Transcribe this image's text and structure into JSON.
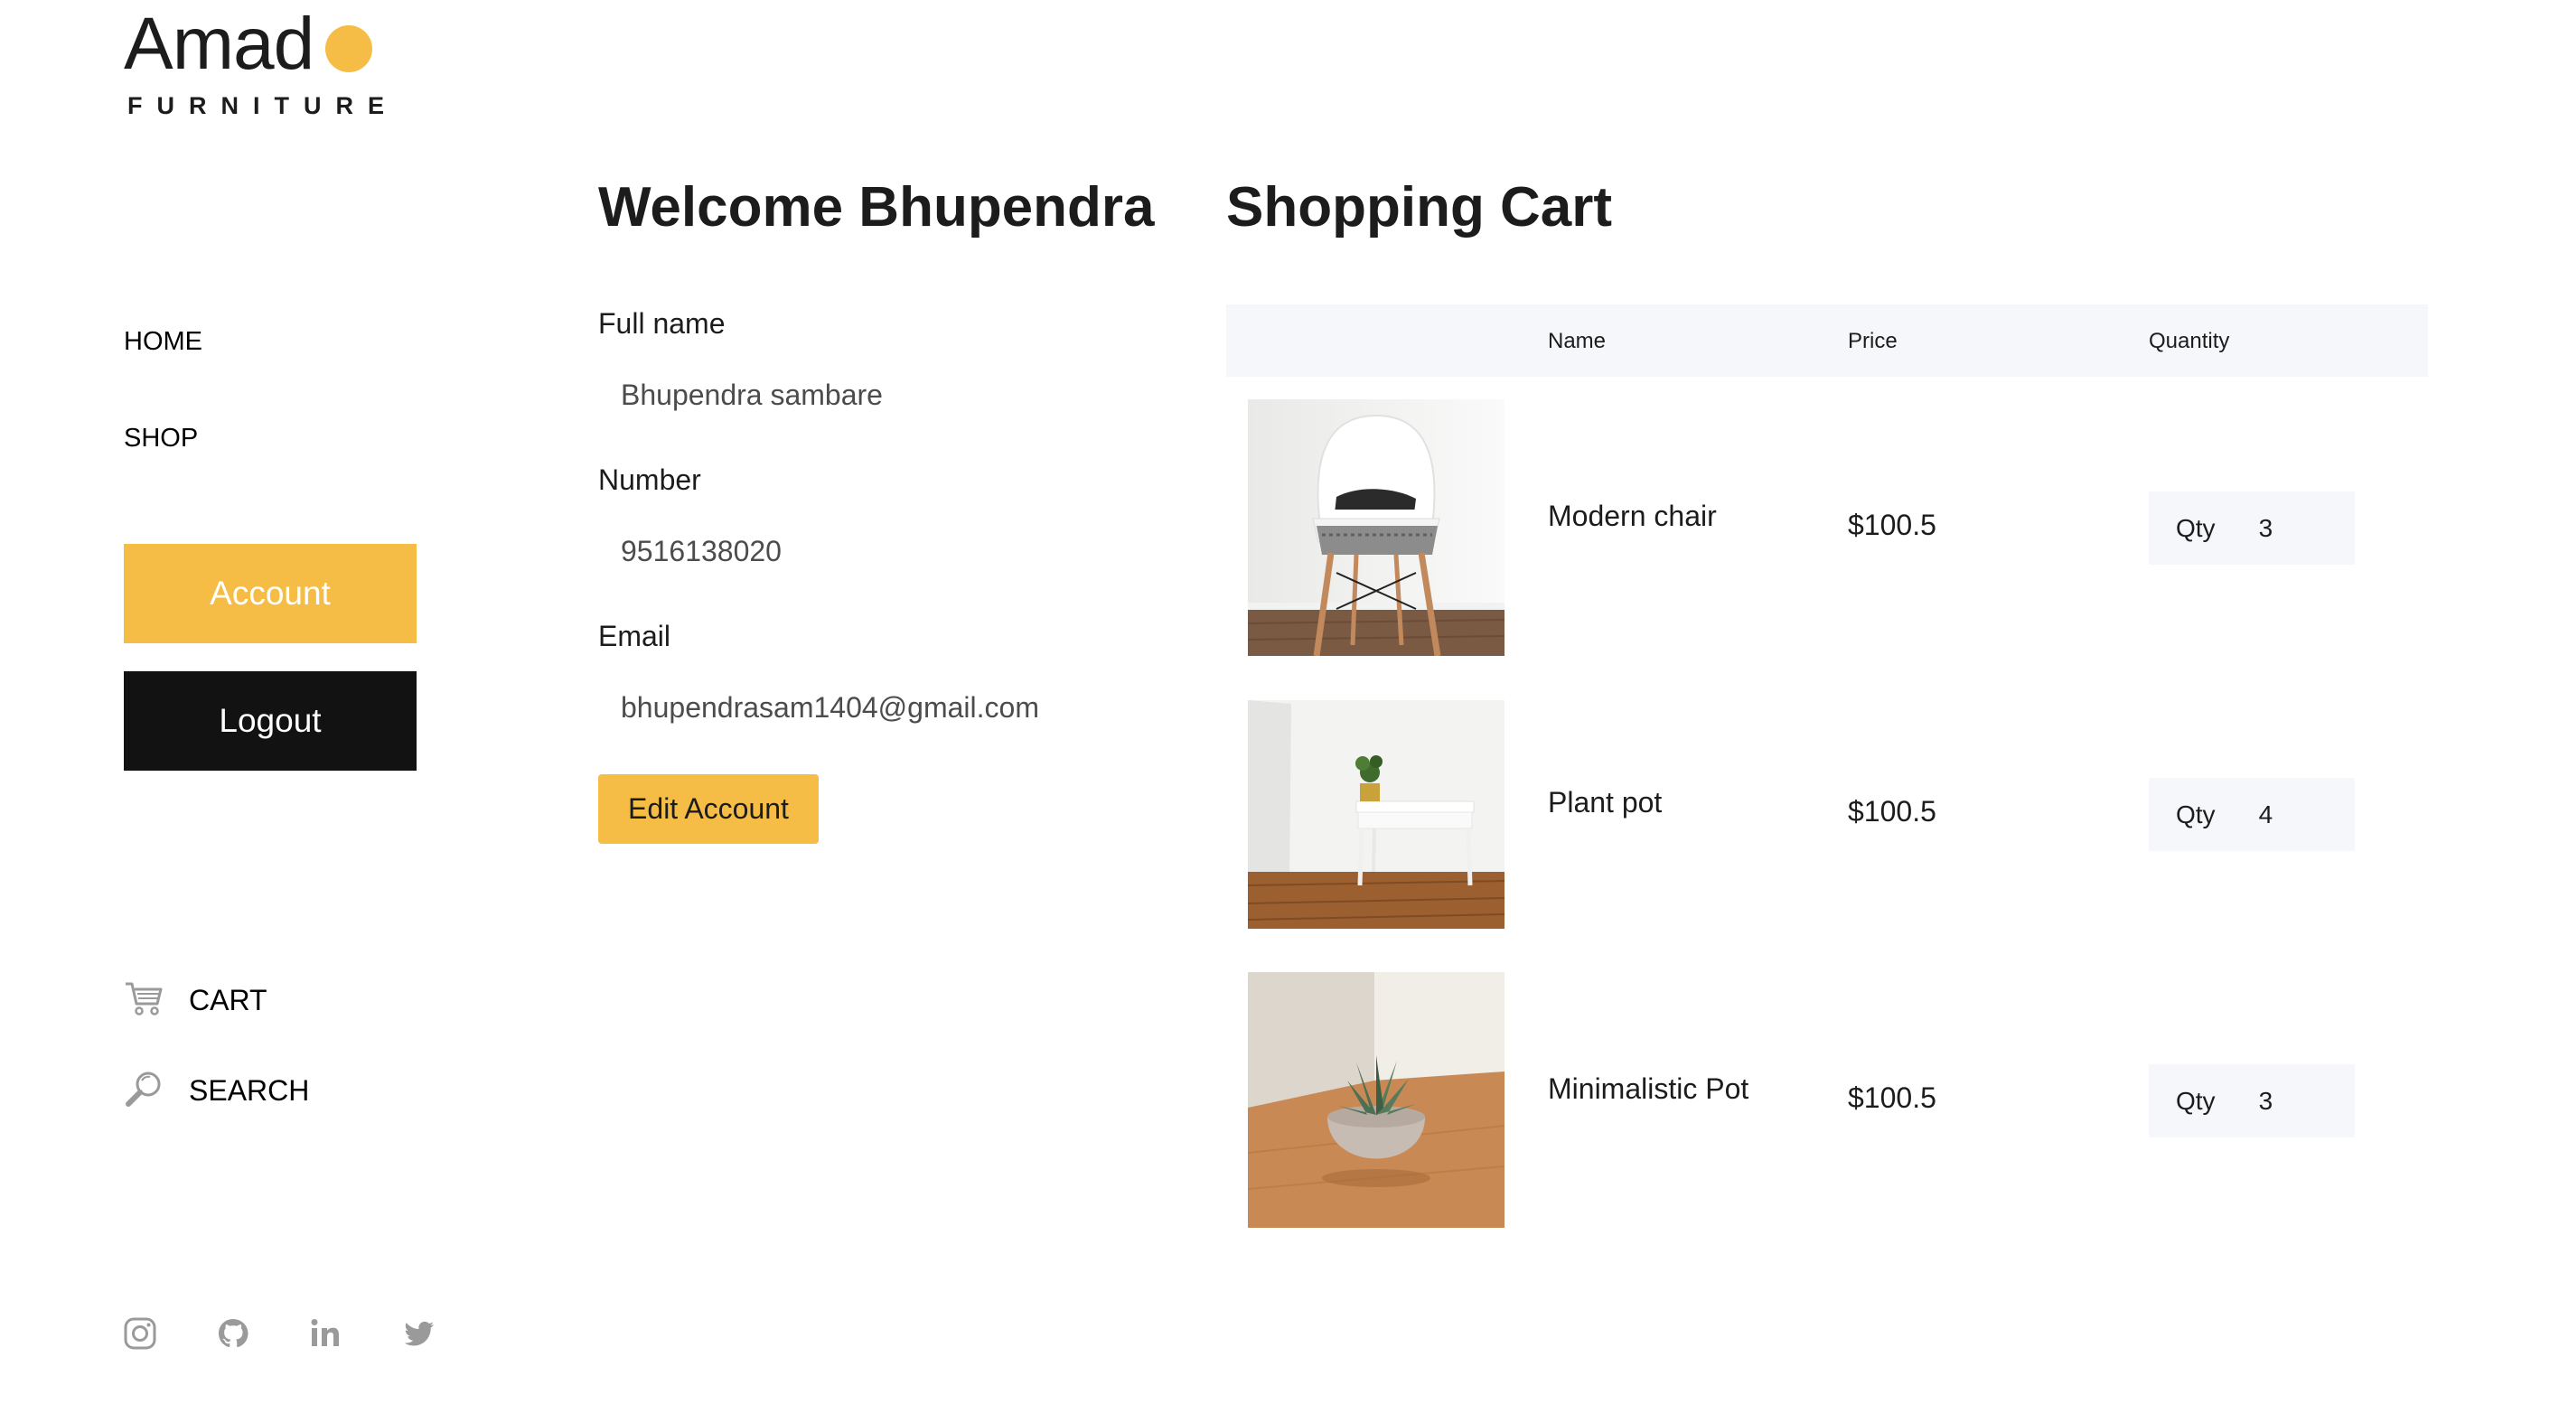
{
  "brand": {
    "name": "Amad",
    "tagline": "FURNITURE",
    "accent": "#f5bd45"
  },
  "nav": {
    "home": "HOME",
    "shop": "SHOP"
  },
  "buttons": {
    "account": "Account",
    "logout": "Logout",
    "edit_account": "Edit Account"
  },
  "side_utils": {
    "cart": "CART",
    "search": "SEARCH"
  },
  "social": [
    "instagram-icon",
    "github-icon",
    "linkedin-icon",
    "twitter-icon"
  ],
  "account": {
    "title": "Welcome Bhupendra",
    "fields": [
      {
        "label": "Full name",
        "value": "Bhupendra sambare"
      },
      {
        "label": "Number",
        "value": "9516138020"
      },
      {
        "label": "Email",
        "value": "bhupendrasam1404@gmail.com"
      }
    ]
  },
  "cart": {
    "title": "Shopping Cart",
    "columns": {
      "name": "Name",
      "price": "Price",
      "quantity": "Quantity"
    },
    "qty_label": "Qty",
    "items": [
      {
        "name": "Modern chair",
        "price": "$100.5",
        "qty": "3",
        "image": "white-chair-photo"
      },
      {
        "name": "Plant pot",
        "price": "$100.5",
        "qty": "4",
        "image": "plant-on-table-photo"
      },
      {
        "name": "Minimalistic Pot",
        "price": "$100.5",
        "qty": "3",
        "image": "succulent-pot-photo"
      }
    ]
  },
  "colors": {
    "yellow": "#f5bd45",
    "black": "#131212",
    "table_bg": "#f5f7fa"
  }
}
